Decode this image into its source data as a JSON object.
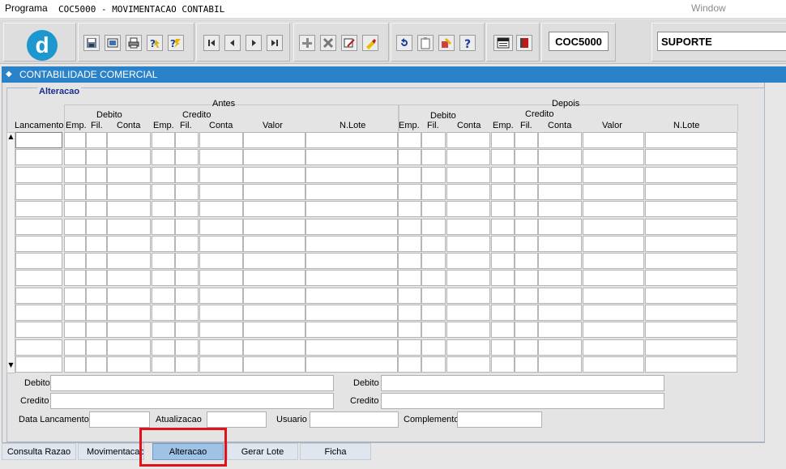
{
  "menubar": {
    "program": "Programa",
    "title": "COC5000 - MOVIMENTACAO CONTABIL",
    "window": "Window"
  },
  "toolbar": {
    "logo": "d",
    "form_code": "COC5000",
    "user": "SUPORTE",
    "icons": [
      "save-icon",
      "print-preview-icon",
      "print-icon",
      "query-help-icon",
      "query-wizard-icon",
      "first-record-icon",
      "previous-record-icon",
      "next-record-icon",
      "last-record-icon",
      "insert-record-icon",
      "delete-record-icon",
      "edit-icon",
      "clear-icon",
      "undo-icon",
      "clipboard-icon",
      "tools-icon",
      "help-icon",
      "menu-icon",
      "exit-icon"
    ]
  },
  "window": {
    "title": "CONTABILIDADE COMERCIAL"
  },
  "frame": {
    "title": "Alteracao"
  },
  "grid": {
    "antes_label": "Antes",
    "depois_label": "Depois",
    "debito_label": "Debito",
    "credito_label": "Credito",
    "columns": {
      "lancamento": "Lancamento",
      "emp": "Emp.",
      "fil": "Fil.",
      "conta": "Conta",
      "valor": "Valor",
      "nlote": "N.Lote"
    },
    "row_count": 14
  },
  "details": {
    "debito_label": "Debito",
    "credito_label": "Credito",
    "debito2_label": "Debito",
    "credito2_label": "Credito",
    "data_lancamento_label": "Data Lancamento",
    "atualizacao_label": "Atualizacao",
    "usuario_label": "Usuario",
    "complemento_label": "Complemento"
  },
  "tabs": [
    {
      "label": "Consulta Razao",
      "active": false
    },
    {
      "label": "Movimentacao",
      "active": false
    },
    {
      "label": "Alteracao",
      "active": true
    },
    {
      "label": "Gerar Lote",
      "active": false
    },
    {
      "label": "Ficha",
      "active": false
    }
  ],
  "colors": {
    "title_bar": "#2a82c8",
    "highlight": "#e0121b",
    "active_tab": "#9ec3e6"
  }
}
